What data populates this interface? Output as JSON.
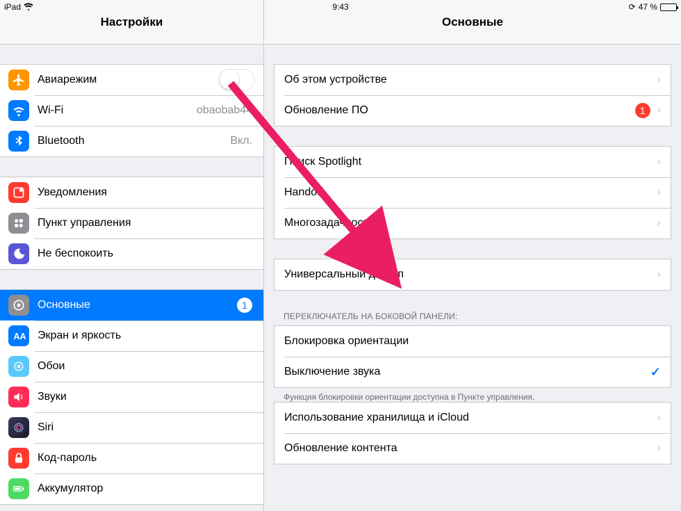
{
  "status": {
    "device": "iPad",
    "time": "9:43",
    "battery": "47 %"
  },
  "sidebar": {
    "title": "Настройки",
    "g1": {
      "airplane": {
        "label": "Авиарежим"
      },
      "wifi": {
        "label": "Wi-Fi",
        "detail": "obaobab44"
      },
      "bluetooth": {
        "label": "Bluetooth",
        "detail": "Вкл."
      }
    },
    "g2": {
      "notifications": {
        "label": "Уведомления"
      },
      "control": {
        "label": "Пункт управления"
      },
      "dnd": {
        "label": "Не беспокоить"
      }
    },
    "g3": {
      "general": {
        "label": "Основные",
        "badge": "1"
      },
      "display": {
        "label": "Экран и яркость"
      },
      "wallpaper": {
        "label": "Обои"
      },
      "sounds": {
        "label": "Звуки"
      },
      "siri": {
        "label": "Siri"
      },
      "passcode": {
        "label": "Код-пароль"
      },
      "battery": {
        "label": "Аккумулятор"
      }
    }
  },
  "content": {
    "title": "Основные",
    "g1": {
      "about": "Об этом устройстве",
      "update": "Обновление ПО",
      "update_badge": "1"
    },
    "g2": {
      "spotlight": "Поиск Spotlight",
      "handoff": "Handoff",
      "multitask": "Многозадачность"
    },
    "g3": {
      "accessibility": "Универсальный доступ"
    },
    "switch_header": "ПЕРЕКЛЮЧАТЕЛЬ НА БОКОВОЙ ПАНЕЛИ:",
    "g4": {
      "lock": "Блокировка ориентации",
      "mute": "Выключение звука"
    },
    "switch_footer": "Функция блокировки ориентации доступна в Пункте управления.",
    "g5": {
      "storage": "Использование хранилища и iCloud",
      "bgrefresh": "Обновление контента"
    }
  }
}
